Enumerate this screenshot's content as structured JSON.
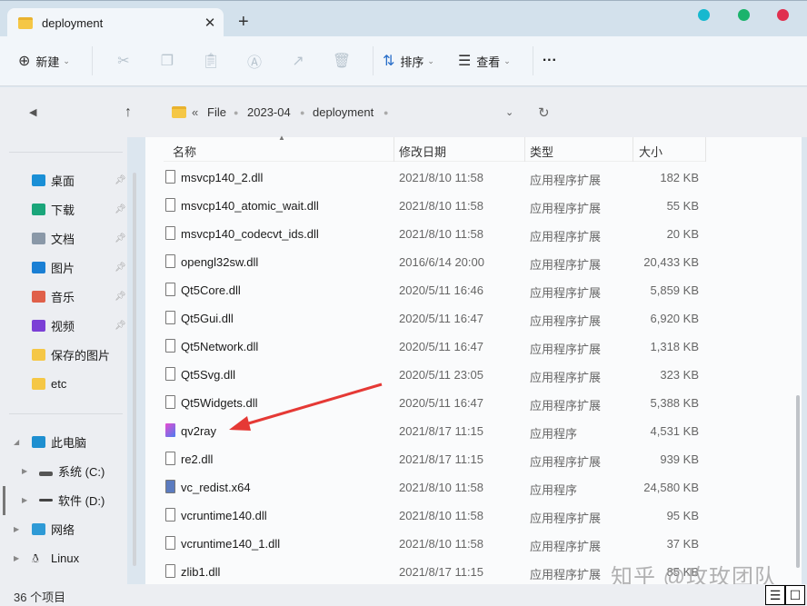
{
  "window": {
    "tab_title": "deployment",
    "close": "✕",
    "new_tab": "+",
    "dots": [
      "#17b8cf",
      "#1cb36c",
      "#e0304f"
    ]
  },
  "toolbar": {
    "new_label": "新建",
    "sort_label": "排序",
    "view_label": "查看",
    "more": "···"
  },
  "address": {
    "prefix": "«",
    "crumbs": [
      "File",
      "2023-04",
      "deployment"
    ]
  },
  "sidebar": {
    "quick": [
      {
        "label": "桌面",
        "pinned": true
      },
      {
        "label": "下载",
        "pinned": true
      },
      {
        "label": "文档",
        "pinned": true
      },
      {
        "label": "图片",
        "pinned": true
      },
      {
        "label": "音乐",
        "pinned": true
      },
      {
        "label": "视频",
        "pinned": true
      },
      {
        "label": "保存的图片",
        "pinned": false
      },
      {
        "label": "etc",
        "pinned": false
      }
    ],
    "pc": "此电脑",
    "drives": [
      "系统 (C:)",
      "软件 (D:)"
    ],
    "network": "网络",
    "linux": "Linux"
  },
  "columns": {
    "name": "名称",
    "date": "修改日期",
    "type": "类型",
    "size": "大小"
  },
  "files": [
    {
      "name": "msvcp140_2.dll",
      "date": "2021/8/10 11:58",
      "type": "应用程序扩展",
      "size": "182 KB"
    },
    {
      "name": "msvcp140_atomic_wait.dll",
      "date": "2021/8/10 11:58",
      "type": "应用程序扩展",
      "size": "55 KB"
    },
    {
      "name": "msvcp140_codecvt_ids.dll",
      "date": "2021/8/10 11:58",
      "type": "应用程序扩展",
      "size": "20 KB"
    },
    {
      "name": "opengl32sw.dll",
      "date": "2016/6/14 20:00",
      "type": "应用程序扩展",
      "size": "20,433 KB"
    },
    {
      "name": "Qt5Core.dll",
      "date": "2020/5/11 16:46",
      "type": "应用程序扩展",
      "size": "5,859 KB"
    },
    {
      "name": "Qt5Gui.dll",
      "date": "2020/5/11 16:47",
      "type": "应用程序扩展",
      "size": "6,920 KB"
    },
    {
      "name": "Qt5Network.dll",
      "date": "2020/5/11 16:47",
      "type": "应用程序扩展",
      "size": "1,318 KB"
    },
    {
      "name": "Qt5Svg.dll",
      "date": "2020/5/11 23:05",
      "type": "应用程序扩展",
      "size": "323 KB"
    },
    {
      "name": "Qt5Widgets.dll",
      "date": "2020/5/11 16:47",
      "type": "应用程序扩展",
      "size": "5,388 KB"
    },
    {
      "name": "qv2ray",
      "date": "2021/8/17 11:15",
      "type": "应用程序",
      "size": "4,531 KB"
    },
    {
      "name": "re2.dll",
      "date": "2021/8/17 11:15",
      "type": "应用程序扩展",
      "size": "939 KB"
    },
    {
      "name": "vc_redist.x64",
      "date": "2021/8/10 11:58",
      "type": "应用程序",
      "size": "24,580 KB"
    },
    {
      "name": "vcruntime140.dll",
      "date": "2021/8/10 11:58",
      "type": "应用程序扩展",
      "size": "95 KB"
    },
    {
      "name": "vcruntime140_1.dll",
      "date": "2021/8/10 11:58",
      "type": "应用程序扩展",
      "size": "37 KB"
    },
    {
      "name": "zlib1.dll",
      "date": "2021/8/17 11:15",
      "type": "应用程序扩展",
      "size": "85 KB"
    }
  ],
  "status": {
    "count": "36 个项目"
  },
  "watermark": "知乎 @玫玫团队"
}
